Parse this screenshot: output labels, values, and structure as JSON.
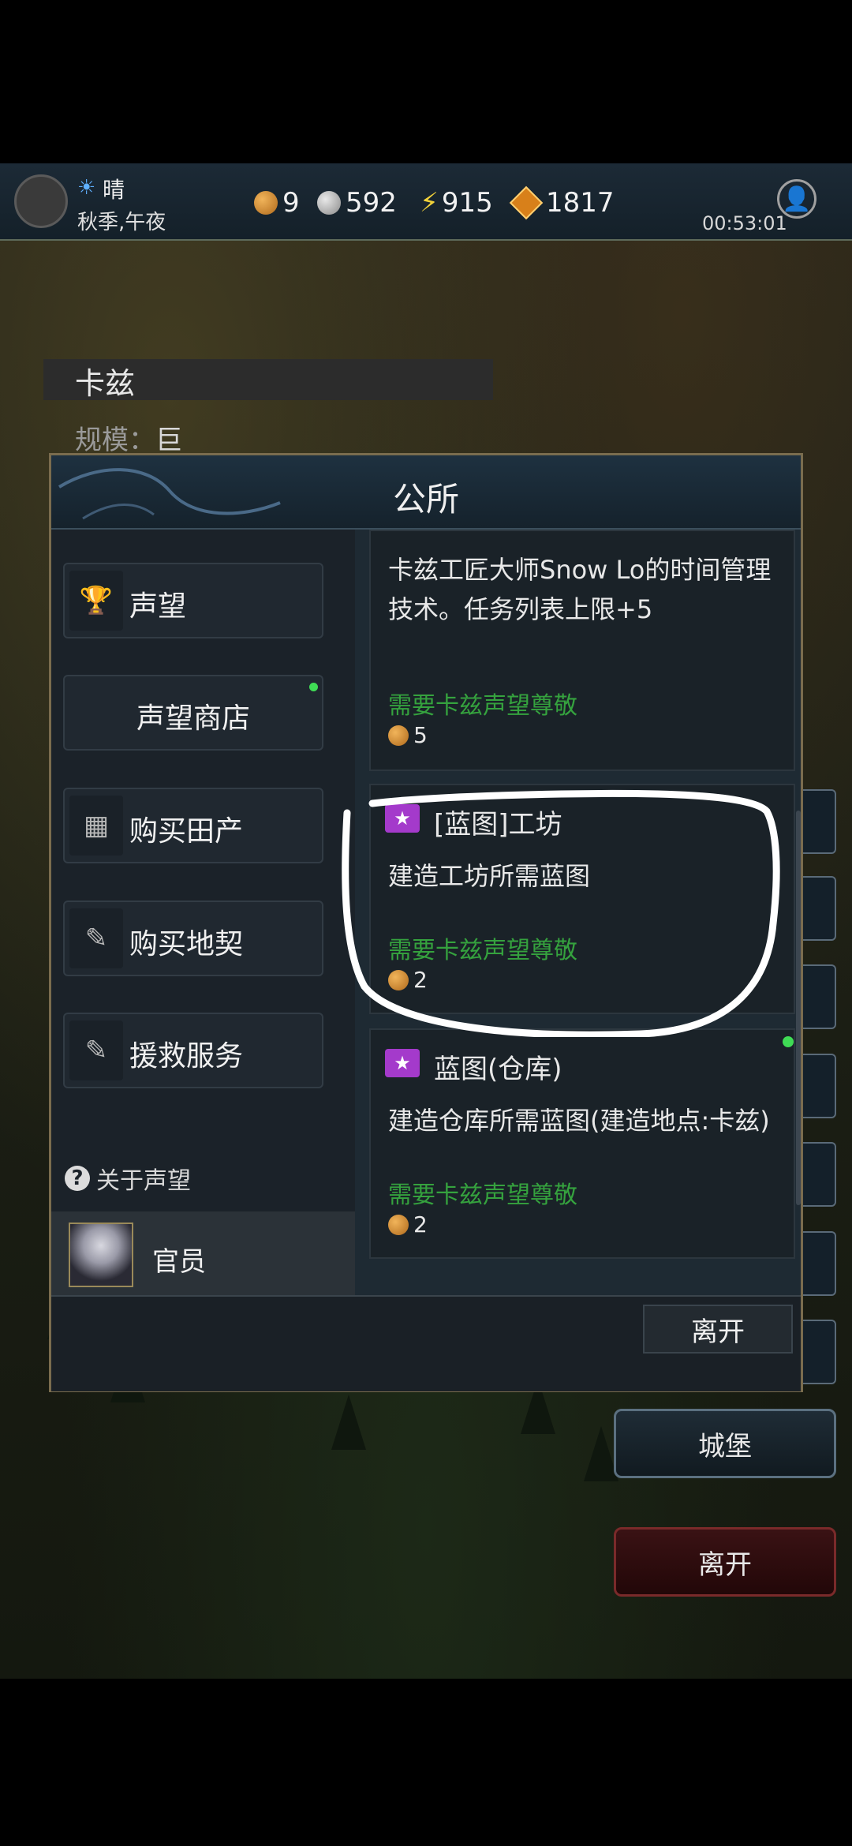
{
  "topbar": {
    "weather_icon": "sun-icon",
    "weather": "晴",
    "season": "秋季,午夜",
    "gold": "9",
    "silver": "592",
    "energy": "915",
    "gems": "1817",
    "timer": "00:53:01"
  },
  "location": {
    "name": "卡兹",
    "scale_label": "规模：",
    "scale_value": "巨"
  },
  "dialog": {
    "title": "公所",
    "menu": [
      {
        "label": "声望",
        "icon": "trophy-icon"
      },
      {
        "label": "声望商店",
        "icon": ""
      },
      {
        "label": "购买田产",
        "icon": "field-icon"
      },
      {
        "label": "购买地契",
        "icon": "deed-icon"
      },
      {
        "label": "援救服务",
        "icon": "deed-icon"
      }
    ],
    "about": "关于声望",
    "officer": "官员",
    "items": [
      {
        "title": "",
        "desc": "卡兹工匠大师Snow Lo的时间管理技术。任务列表上限+5",
        "requirement": "需要卡兹声望尊敬",
        "cost": "5"
      },
      {
        "title": "[蓝图]工坊",
        "desc": "建造工坊所需蓝图",
        "requirement": "需要卡兹声望尊敬",
        "cost": "2"
      },
      {
        "title": "蓝图(仓库)",
        "desc": "建造仓库所需蓝图(建造地点:卡兹)",
        "requirement": "需要卡兹声望尊敬",
        "cost": "2"
      }
    ],
    "leave": "离开"
  },
  "side_buttons": {
    "castle": "城堡",
    "leave": "离开"
  },
  "colors": {
    "requirement_green": "#35a23e",
    "ticket_purple": "#a43acb",
    "dialog_border": "#7a6c4e"
  }
}
